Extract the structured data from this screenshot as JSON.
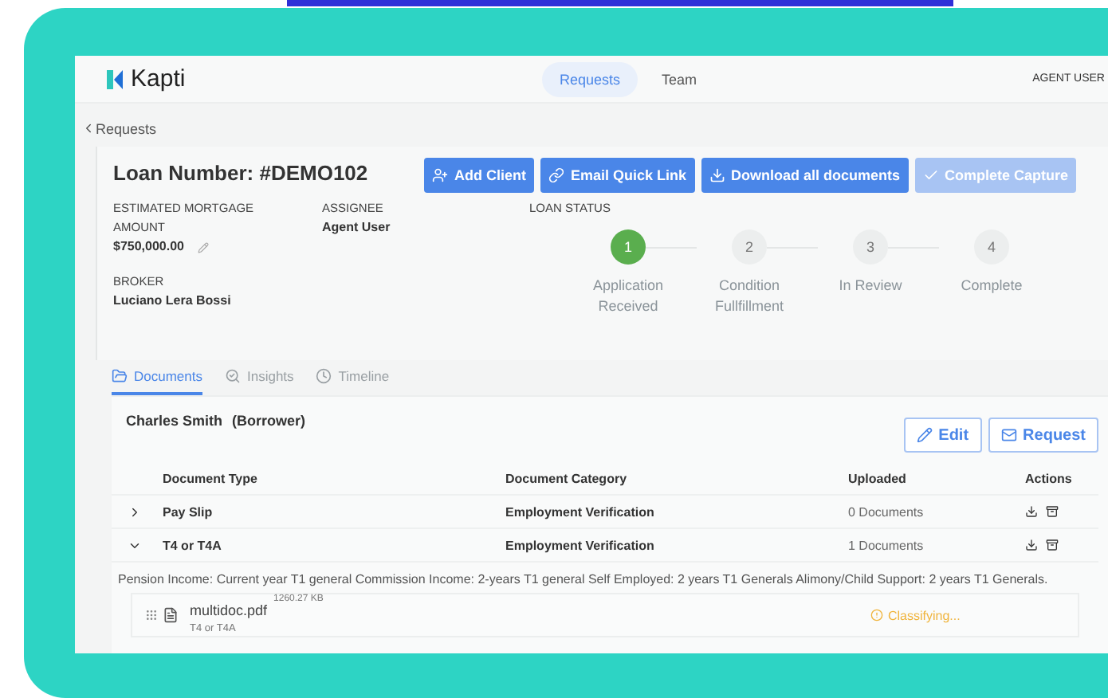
{
  "app": {
    "logo": "Kapti",
    "nav": [
      {
        "label": "Requests",
        "selected": true
      },
      {
        "label": "Team",
        "selected": false
      }
    ],
    "user": "AGENT USER"
  },
  "breadcrumb": "Requests",
  "loan": {
    "title": "Loan Number: #DEMO102",
    "actions": [
      {
        "label": "Add Client",
        "disabled": false
      },
      {
        "label": "Email Quick Link",
        "disabled": false
      },
      {
        "label": "Download all documents",
        "disabled": false
      },
      {
        "label": "Complete Capture",
        "disabled": true
      }
    ],
    "amount": {
      "label": "ESTIMATED MORTGAGE AMOUNT",
      "value": "$750,000.00"
    },
    "assignee": {
      "label": "ASSIGNEE",
      "value": "Agent User"
    },
    "broker": {
      "label": "BROKER",
      "value": "Luciano Lera Bossi"
    },
    "status": {
      "label": "LOAN STATUS",
      "steps": [
        {
          "number": "1",
          "label": "Application Received",
          "selected": true
        },
        {
          "number": "2",
          "label": "Condition Fullfillment",
          "selected": false
        },
        {
          "number": "3",
          "label": "In Review",
          "selected": false
        },
        {
          "number": "4",
          "label": "Complete",
          "selected": false
        }
      ]
    }
  },
  "tabs": [
    {
      "label": "Documents",
      "selected": true
    },
    {
      "label": "Insights",
      "selected": false
    },
    {
      "label": "Timeline",
      "selected": false
    }
  ],
  "borrower": {
    "name": "Charles Smith",
    "role": "(Borrower)",
    "buttons": [
      {
        "label": "Edit"
      },
      {
        "label": "Request"
      }
    ]
  },
  "table": {
    "columns": [
      "Document Type",
      "Document Category",
      "Uploaded",
      "Actions"
    ],
    "rows": [
      {
        "expanded": false,
        "type": "Pay Slip",
        "category": "Employment Verification",
        "uploaded": "0 Documents"
      },
      {
        "expanded": true,
        "type": "T4 or T4A",
        "category": "Employment Verification",
        "uploaded": "1 Documents",
        "description": "Pension Income: Current year T1 general Commission Income: 2-years T1 general Self Employed: 2 years T1 Generals Alimony/Child Support: 2 years T1 Generals.",
        "files": [
          {
            "name": "multidoc.pdf",
            "size": "1260.27 KB",
            "type": "T4 or T4A",
            "status": "Classifying..."
          }
        ]
      }
    ]
  }
}
